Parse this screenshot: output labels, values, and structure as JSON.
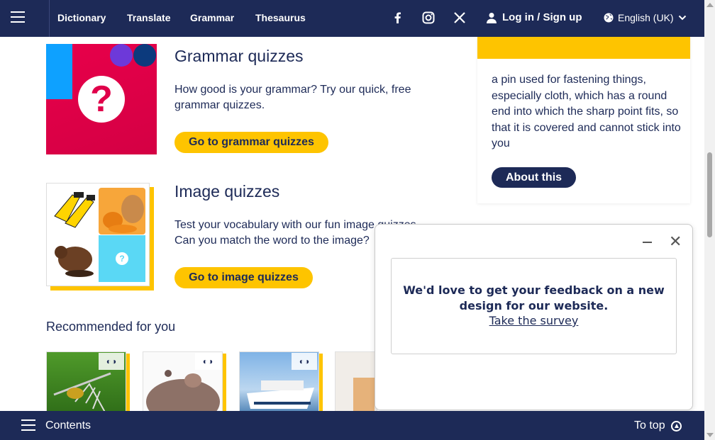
{
  "nav": {
    "links": [
      "Dictionary",
      "Translate",
      "Grammar",
      "Thesaurus"
    ],
    "social": [
      "facebook-icon",
      "instagram-icon",
      "x-icon"
    ],
    "login_label": "Log in / Sign up",
    "language_label": "English (UK)"
  },
  "quizzes": [
    {
      "title": "Grammar quizzes",
      "desc_line1": "How good is your grammar? Try our quick, free",
      "desc_line2": "grammar quizzes.",
      "button": "Go to grammar quizzes"
    },
    {
      "title": "Image quizzes",
      "desc_line1": "Test your vocabulary with our fun image quizzes",
      "desc_line2": "Can you match the word to the image?",
      "button": "Go to image quizzes"
    }
  ],
  "recommended": {
    "title": "Recommended for you"
  },
  "sidebar": {
    "definition": "a pin used for fastening things, especially cloth, which has a round end into which the sharp point fits, so that it is covered and cannot stick into you",
    "about_button": "About this"
  },
  "feedback": {
    "message_line1": "We'd love to get your feedback on a new",
    "message_line2": "design for our website.",
    "link": "Take the survey"
  },
  "bottom": {
    "contents_label": "Contents",
    "totop_label": "To top"
  },
  "colors": {
    "navy": "#1d2a57",
    "yellow": "#fec400",
    "magenta": "#e0004a"
  }
}
